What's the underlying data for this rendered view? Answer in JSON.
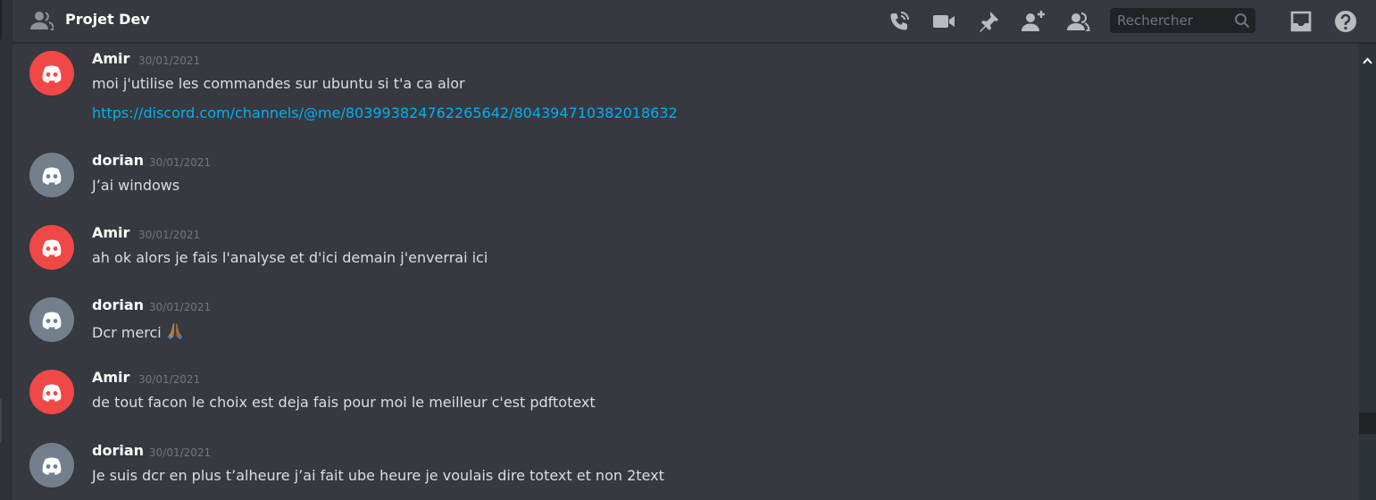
{
  "channel": {
    "title": "Projet Dev"
  },
  "toolbar": {
    "icons": [
      "call-icon",
      "video-icon",
      "pin-icon",
      "add-member-icon",
      "member-list-icon",
      "inbox-icon",
      "help-icon"
    ],
    "search_placeholder": "Rechercher"
  },
  "colors": {
    "accent_link": "#00b0f4",
    "avatar_red": "#f04747",
    "avatar_grey": "#747f8d",
    "background": "#36393f"
  },
  "messages": [
    {
      "author": "Amir",
      "timestamp": "30/01/2021",
      "text": "moi j'utilise les commandes sur ubuntu si t'a ca alor",
      "link": "https://discord.com/channels/@me/803993824762265642/804394710382018632",
      "avatar": "red"
    },
    {
      "author": "dorian",
      "timestamp": "30/01/2021",
      "text": "J’ai windows",
      "avatar": "grey"
    },
    {
      "author": "Amir",
      "timestamp": "30/01/2021",
      "text": "ah ok alors je fais l'analyse et d'ici demain j'enverrai ici",
      "avatar": "red"
    },
    {
      "author": "dorian",
      "timestamp": "30/01/2021",
      "text": "Dcr merci",
      "emoji": "folded-hands",
      "avatar": "grey"
    },
    {
      "author": "Amir",
      "timestamp": "30/01/2021",
      "text": "de tout facon le choix est deja fais pour moi le meilleur c'est pdftotext",
      "avatar": "red"
    },
    {
      "author": "dorian",
      "timestamp": "30/01/2021",
      "text": "Je suis dcr en plus t’alheure j’ai fait ube heure je voulais dire totext et non 2text",
      "avatar": "grey"
    }
  ]
}
